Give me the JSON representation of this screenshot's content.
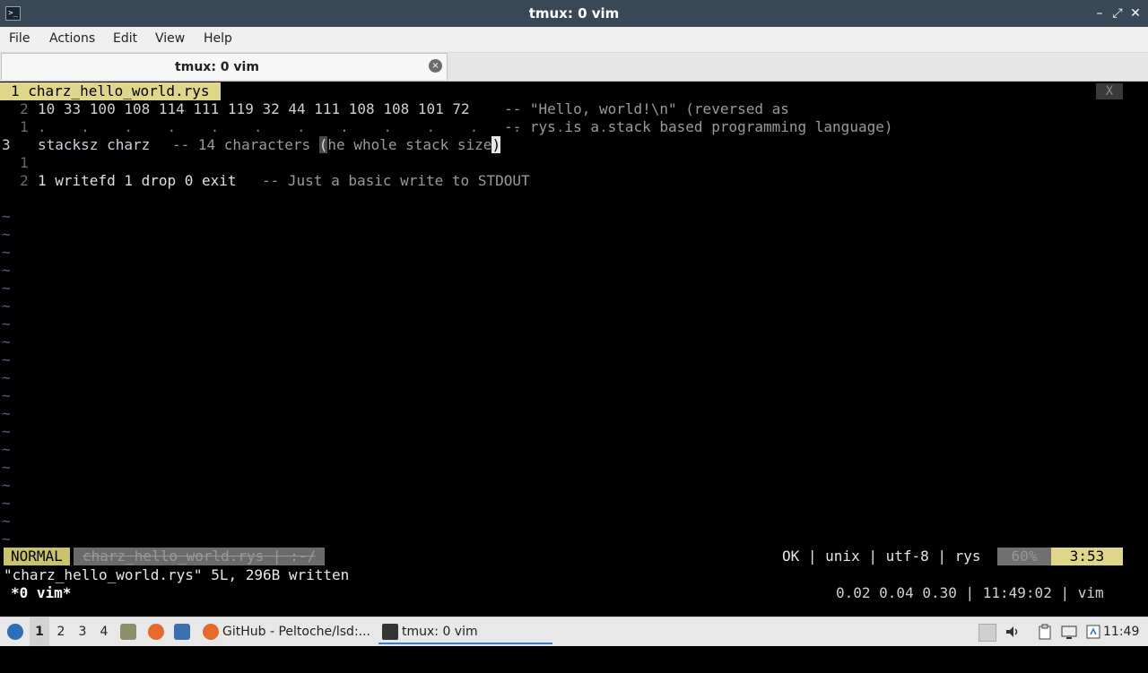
{
  "window": {
    "title": "tmux: 0 vim",
    "app_icon": ">_"
  },
  "menubar": {
    "items": [
      "File",
      "Actions",
      "Edit",
      "View",
      "Help"
    ]
  },
  "tab": {
    "label": "tmux: 0 vim",
    "close": "×"
  },
  "vim": {
    "buffer_line": "1 charz_hello_world.rys",
    "close_label": "X",
    "lines": [
      {
        "num": "2",
        "code": "10 33 100 108 114 111 119 32 44 111 108 108 101 72",
        "comment": "-- \"Hello, world!\\n\" (reversed as"
      },
      {
        "num": "1",
        "dots": ".    .    .    .    .    .    .    .    .    .    .    .    .    .",
        "comment": "-- rys is a stack based programming language)"
      },
      {
        "num": "3",
        "code": "stacksz charz",
        "comment_pre": "-- 14 characters ",
        "paren_open": "(",
        "comment_mid": "he whole stack size",
        "paren_close": ")"
      },
      {
        "num": "1",
        "code": ""
      },
      {
        "num": "2",
        "code": "1 writefd 1 drop 0 exit",
        "comment": "-- Just a basic write to STDOUT"
      }
    ],
    "tilde": "~",
    "status": {
      "mode": "NORMAL",
      "filename": "charz_hello_world.rys | :-/",
      "right": "OK | unix | utf-8 | rys",
      "percent": "60%",
      "position": "3:53"
    },
    "message": "\"charz_hello_world.rys\" 5L, 296B written"
  },
  "tmux": {
    "window": "*0 vim*",
    "right": "0.02 0.04 0.30 | 11:49:02 | vim"
  },
  "taskbar": {
    "workspaces": [
      "1",
      "2",
      "3",
      "4"
    ],
    "tasks": [
      {
        "label": "GitHub - Peltoche/lsd:..."
      },
      {
        "label": "tmux: 0 vim"
      }
    ],
    "clock": "11:49"
  }
}
